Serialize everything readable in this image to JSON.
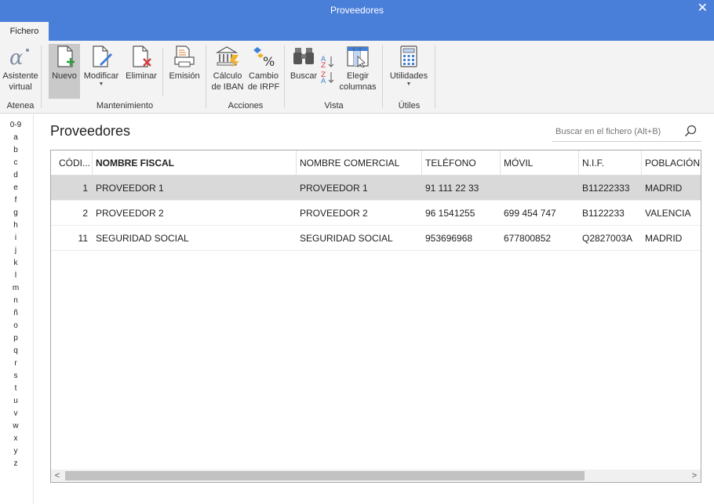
{
  "window": {
    "title": "Proveedores",
    "close_glyph": "✕"
  },
  "tabs": [
    {
      "label": "Fichero",
      "selected": true
    }
  ],
  "ribbon": {
    "buttons": [
      {
        "label1": "Asistente",
        "label2": "virtual",
        "icon": "atenea-alpha-icon"
      },
      {
        "label1": "Nuevo",
        "label2": "",
        "icon": "new-document-icon"
      },
      {
        "label1": "Modificar",
        "label2": "",
        "icon": "edit-document-icon"
      },
      {
        "label1": "Eliminar",
        "label2": "",
        "icon": "delete-document-icon"
      },
      {
        "label1": "Emisión",
        "label2": "",
        "icon": "print-icon"
      },
      {
        "label1": "Cálculo",
        "label2": "de IBAN",
        "icon": "bank-icon"
      },
      {
        "label1": "Cambio",
        "label2": "de IRPF",
        "icon": "percent-icon"
      },
      {
        "label1": "Buscar",
        "label2": "",
        "icon": "binoculars-icon"
      },
      {
        "label1": "",
        "label2": "",
        "icon": "sort-az-icon"
      },
      {
        "label1": "Elegir",
        "label2": "columnas",
        "icon": "columns-icon"
      },
      {
        "label1": "Utilidades",
        "label2": "",
        "icon": "calculator-icon"
      }
    ],
    "groups": [
      "Atenea",
      "Mantenimiento",
      "Acciones",
      "Vista",
      "Útiles"
    ]
  },
  "alphabet": [
    "0-9",
    "a",
    "b",
    "c",
    "d",
    "e",
    "f",
    "g",
    "h",
    "i",
    "j",
    "k",
    "l",
    "m",
    "n",
    "ñ",
    "o",
    "p",
    "q",
    "r",
    "s",
    "t",
    "u",
    "v",
    "w",
    "x",
    "y",
    "z"
  ],
  "page": {
    "title": "Proveedores"
  },
  "search": {
    "placeholder": "Buscar en el fichero (Alt+B)"
  },
  "table": {
    "columns": [
      "CÓDI...",
      "NOMBRE FISCAL",
      "NOMBRE COMERCIAL",
      "TELÉFONO",
      "MÓVIL",
      "N.I.F.",
      "POBLACIÓN"
    ],
    "rows": [
      [
        "1",
        "PROVEEDOR 1",
        "PROVEEDOR 1",
        "91 111 22 33",
        "",
        "B11222333",
        "MADRID"
      ],
      [
        "2",
        "PROVEEDOR 2",
        "PROVEEDOR 2",
        "96 1541255",
        "699 454 747",
        "B1122233",
        "VALENCIA"
      ],
      [
        "11",
        "SEGURIDAD SOCIAL",
        "SEGURIDAD SOCIAL",
        "953696968",
        "677800852",
        "Q2827003A",
        "MADRID"
      ]
    ],
    "selected_row": 0
  },
  "colors": {
    "titlebar": "#4a7fd9",
    "ribbon": "#f3f3f3",
    "selected_row": "#d9d9d9"
  }
}
